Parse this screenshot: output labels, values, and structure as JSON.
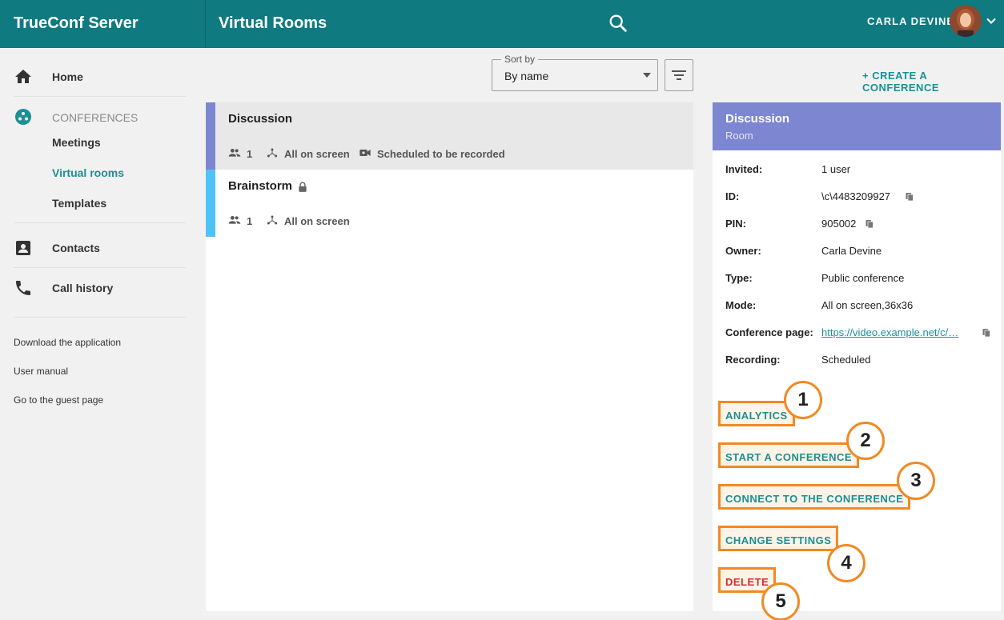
{
  "header": {
    "brand": "TrueConf Server",
    "page_title": "Virtual Rooms",
    "user_name": "CARLA DEVINE"
  },
  "sidebar": {
    "home": "Home",
    "conferences": "CONFERENCES",
    "meetings": "Meetings",
    "virtual_rooms": "Virtual rooms",
    "templates": "Templates",
    "contacts": "Contacts",
    "call_history": "Call history",
    "footer_links": [
      "Download the application",
      "User manual",
      "Go to the guest page"
    ]
  },
  "toolbar": {
    "sort_label": "Sort by",
    "sort_value": "By name",
    "create_label": "+ CREATE A CONFERENCE"
  },
  "rooms": [
    {
      "name": "Discussion",
      "participants": "1",
      "mode": "All on screen",
      "recording": "Scheduled to be recorded",
      "selected": true,
      "color": "#7d86d1"
    },
    {
      "name": "Brainstorm",
      "participants": "1",
      "mode": "All on screen",
      "locked": true,
      "color": "#4fc3f7"
    }
  ],
  "details": {
    "title": "Discussion",
    "subtitle": "Room",
    "rows": [
      {
        "label": "Invited:",
        "value": "1 user"
      },
      {
        "label": "ID:",
        "value": "\\c\\4483209927"
      },
      {
        "label": "PIN:",
        "value": "905002"
      },
      {
        "label": "Owner:",
        "value": "Carla Devine"
      },
      {
        "label": "Type:",
        "value": "Public conference"
      },
      {
        "label": "Mode:",
        "value": "All on screen,36x36"
      },
      {
        "label": "Conference page:",
        "value": "https://video.example.net/c/…"
      },
      {
        "label": "Recording:",
        "value": "Scheduled"
      }
    ],
    "actions": [
      {
        "label": "ANALYTICS",
        "badge": "1"
      },
      {
        "label": "START A CONFERENCE",
        "badge": "2"
      },
      {
        "label": "CONNECT TO THE CONFERENCE",
        "badge": "3"
      },
      {
        "label": "CHANGE SETTINGS",
        "badge": "4"
      },
      {
        "label": "DELETE",
        "badge": "5"
      }
    ]
  },
  "colors": {
    "topbar": "#0f7a80",
    "accent": "#1a8f96",
    "details_header": "#7d86d1",
    "highlight": "#f08a24",
    "danger": "#d32f2f"
  }
}
